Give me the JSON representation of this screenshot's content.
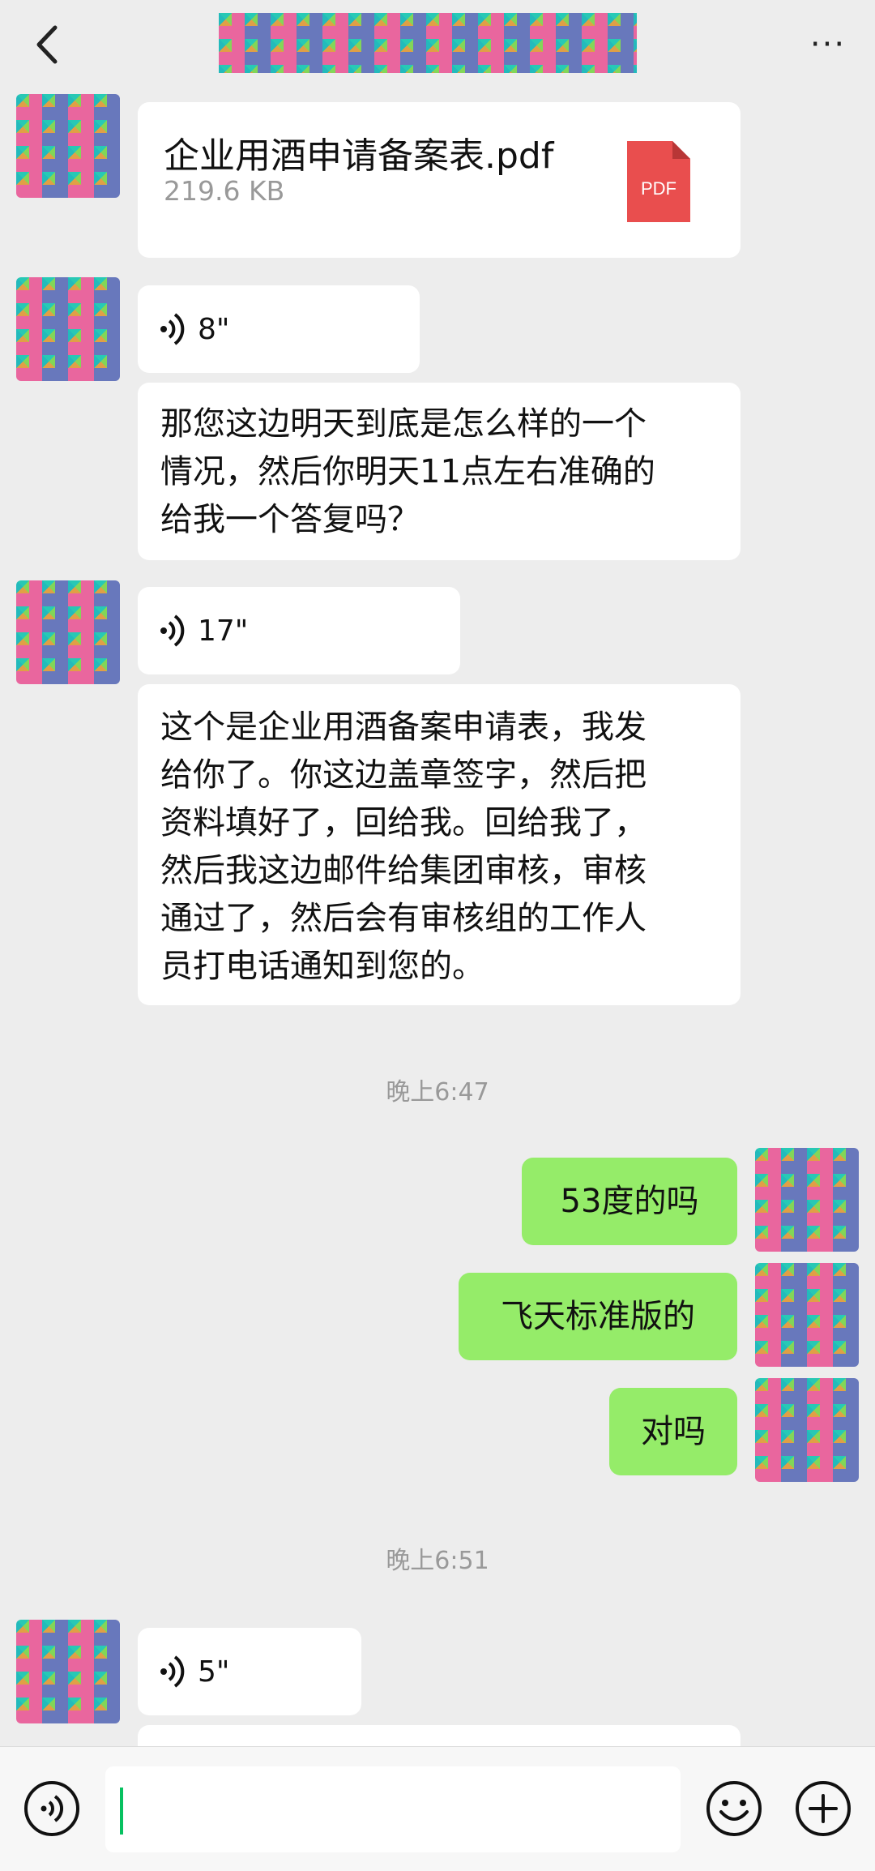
{
  "header": {
    "back_icon": "chevron-left-icon",
    "more_label": "···"
  },
  "messages": {
    "file": {
      "name": "企业用酒申请备案表.pdf",
      "size": "219.6 KB",
      "icon_label": "PDF"
    },
    "voice1": {
      "duration": "8\""
    },
    "text1": {
      "lines": [
        "那您这边明天到底是怎么样的一个",
        "情况，然后你明天11点左右准确的",
        "给我一个答复吗？"
      ]
    },
    "voice2": {
      "duration": "17\""
    },
    "text2": {
      "lines": [
        "这个是企业用酒备案申请表，我发",
        "给你了。你这边盖章签字，然后把",
        "资料填好了，回给我。回给我了，",
        "然后我这边邮件给集团审核，审核",
        "通过了，然后会有审核组的工作人",
        "员打电话通知到您的。"
      ]
    },
    "time1": "晚上6:47",
    "out1": "53度的吗",
    "out2": "飞天标准版的",
    "out3": "对吗",
    "time2": "晚上6:51",
    "voice3": {
      "duration": "5\""
    }
  },
  "colors": {
    "background": "#ededed",
    "outgoing_bubble": "#95ec69",
    "accent": "#07c160",
    "pdf": "#e94e4e"
  },
  "input": {
    "value": ""
  }
}
